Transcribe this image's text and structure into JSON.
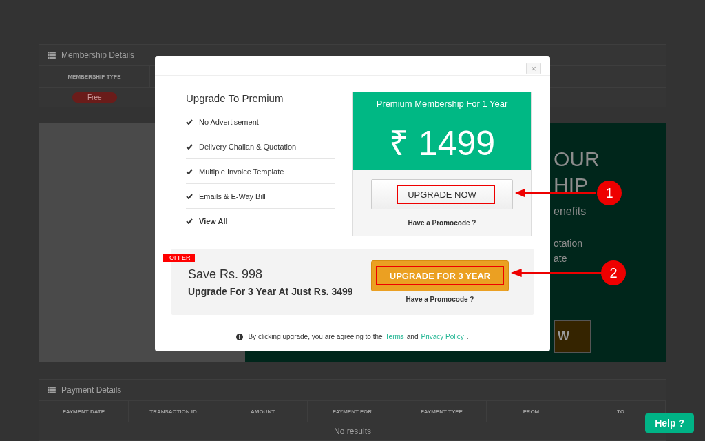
{
  "membership_panel": {
    "title": "Membership Details",
    "columns": [
      "MEMBERSHIP TYPE"
    ],
    "badge": "Free"
  },
  "banner": {
    "lines": [
      "OUR",
      "HIP",
      "enefits",
      "otation",
      "ate"
    ],
    "button": "W"
  },
  "payment_panel": {
    "title": "Payment Details",
    "columns": [
      "PAYMENT DATE",
      "TRANSACTION ID",
      "AMOUNT",
      "PAYMENT FOR",
      "PAYMENT TYPE",
      "FROM",
      "TO"
    ],
    "empty": "No results"
  },
  "help_button": "Help ?",
  "modal": {
    "close": "×",
    "title": "Upgrade To Premium",
    "features": [
      {
        "label": "No Advertisement",
        "kind": "text"
      },
      {
        "label": "Delivery Challan & Quotation",
        "kind": "text"
      },
      {
        "label": "Multiple Invoice Template",
        "kind": "text"
      },
      {
        "label": "Emails & E-Way Bill",
        "kind": "text"
      },
      {
        "label": "View All",
        "kind": "link"
      }
    ],
    "plan": {
      "header": "Premium Membership For 1 Year",
      "price": "₹ 1499",
      "button": "UPGRADE NOW",
      "promo": "Have a Promocode ?"
    },
    "offer": {
      "tag": "OFFER",
      "save": "Save Rs. 998",
      "detail": "Upgrade For 3 Year At Just Rs. 3499",
      "button": "UPGRADE FOR 3 YEAR",
      "promo": "Have a Promocode ?"
    },
    "footer": {
      "text": "By clicking upgrade, you are agreeing to the",
      "terms": "Terms",
      "and": "and",
      "privacy": "Privacy Policy",
      "end": "."
    }
  },
  "callouts": [
    {
      "number": "1"
    },
    {
      "number": "2"
    }
  ]
}
